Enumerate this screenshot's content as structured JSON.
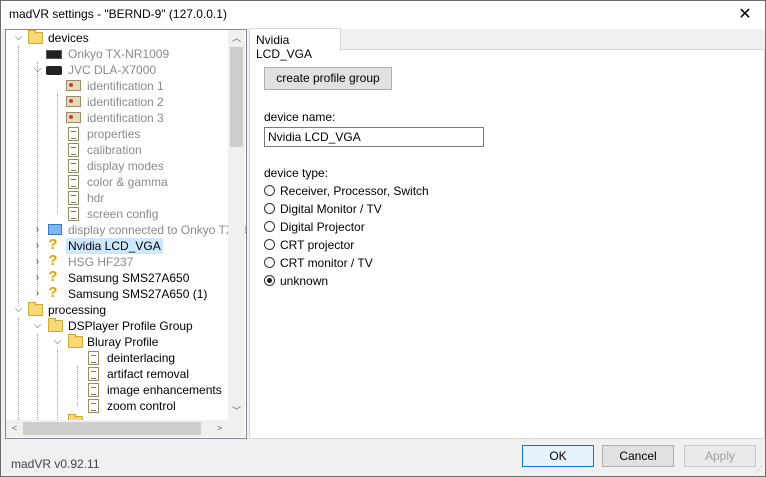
{
  "window": {
    "title": "madVR settings - \"BERND-9\" (127.0.0.1)"
  },
  "tree": {
    "items": [
      {
        "label": "devices",
        "icon": "folder-icon",
        "expander": "expanded"
      },
      {
        "label": "Onkyo TX-NR1009",
        "icon": "av-receiver-icon",
        "expander": "none"
      },
      {
        "label": "JVC DLA-X7000",
        "icon": "projector-icon",
        "expander": "expanded"
      },
      {
        "label": "identification 1",
        "icon": "id-card-icon",
        "expander": "none"
      },
      {
        "label": "identification 2",
        "icon": "id-card-icon",
        "expander": "none"
      },
      {
        "label": "identification 3",
        "icon": "id-card-icon",
        "expander": "none"
      },
      {
        "label": "properties",
        "icon": "document-icon",
        "expander": "none"
      },
      {
        "label": "calibration",
        "icon": "document-icon",
        "expander": "none"
      },
      {
        "label": "display modes",
        "icon": "document-icon",
        "expander": "none"
      },
      {
        "label": "color & gamma",
        "icon": "document-icon",
        "expander": "none"
      },
      {
        "label": "hdr",
        "icon": "document-icon",
        "expander": "none"
      },
      {
        "label": "screen config",
        "icon": "document-icon",
        "expander": "none"
      },
      {
        "label": "display connected to Onkyo TX-N",
        "icon": "monitor-icon",
        "expander": "collapsed"
      },
      {
        "label": "Nvidia LCD_VGA",
        "icon": "question-icon",
        "expander": "collapsed"
      },
      {
        "label": "HSG HF237",
        "icon": "question-icon",
        "expander": "collapsed"
      },
      {
        "label": "Samsung SMS27A650",
        "icon": "question-icon",
        "expander": "collapsed"
      },
      {
        "label": "Samsung SMS27A650 (1)",
        "icon": "question-icon",
        "expander": "collapsed"
      },
      {
        "label": "processing",
        "icon": "folder-icon",
        "expander": "expanded"
      },
      {
        "label": "DSPlayer Profile Group",
        "icon": "folder-icon",
        "expander": "expanded"
      },
      {
        "label": "Bluray Profile",
        "icon": "folder-icon",
        "expander": "expanded"
      },
      {
        "label": "deinterlacing",
        "icon": "document-icon",
        "expander": "none"
      },
      {
        "label": "artifact removal",
        "icon": "document-icon",
        "expander": "none"
      },
      {
        "label": "image enhancements",
        "icon": "document-icon",
        "expander": "none"
      },
      {
        "label": "zoom control",
        "icon": "document-icon",
        "expander": "none"
      }
    ]
  },
  "tab": {
    "label": "Nvidia LCD_VGA"
  },
  "panel": {
    "create_group_label": "create profile group",
    "device_name_label": "device name:",
    "device_name_value": "Nvidia LCD_VGA",
    "device_type_label": "device type:",
    "device_types": [
      {
        "label": "Receiver, Processor, Switch",
        "checked": false
      },
      {
        "label": "Digital Monitor / TV",
        "checked": false
      },
      {
        "label": "Digital Projector",
        "checked": false
      },
      {
        "label": "CRT projector",
        "checked": false
      },
      {
        "label": "CRT monitor / TV",
        "checked": false
      },
      {
        "label": "unknown",
        "checked": true
      }
    ]
  },
  "footer": {
    "version": "madVR v0.92.11",
    "ok_label": "OK",
    "cancel_label": "Cancel",
    "apply_label": "Apply"
  }
}
